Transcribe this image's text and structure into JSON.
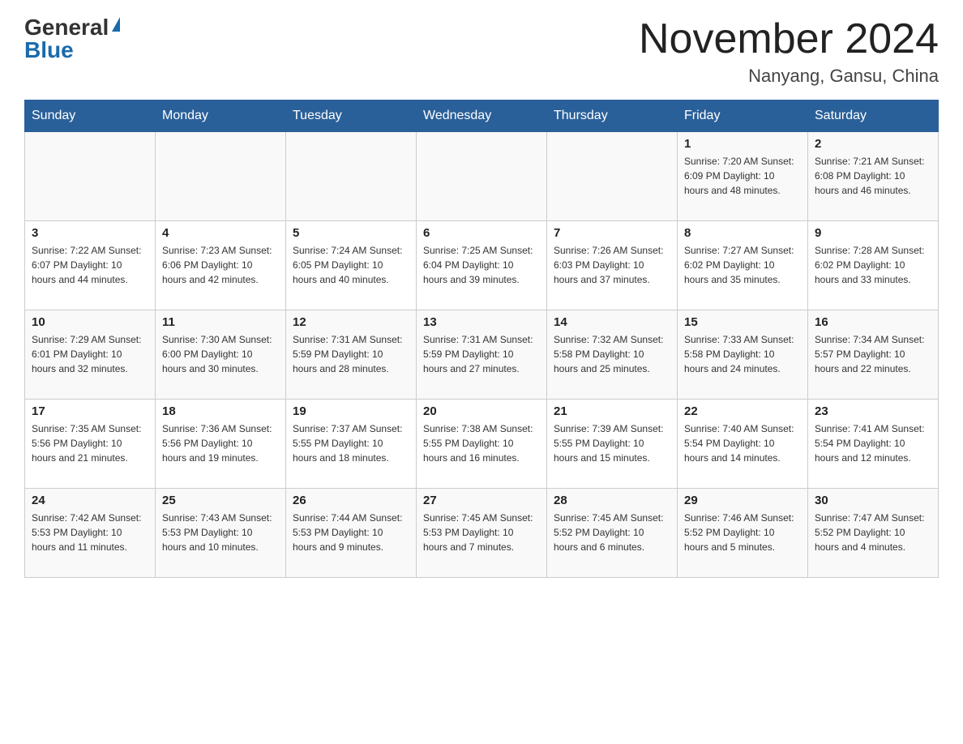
{
  "header": {
    "logo_general": "General",
    "logo_blue": "Blue",
    "title": "November 2024",
    "subtitle": "Nanyang, Gansu, China"
  },
  "days_of_week": [
    "Sunday",
    "Monday",
    "Tuesday",
    "Wednesday",
    "Thursday",
    "Friday",
    "Saturday"
  ],
  "weeks": [
    [
      {
        "day": "",
        "info": ""
      },
      {
        "day": "",
        "info": ""
      },
      {
        "day": "",
        "info": ""
      },
      {
        "day": "",
        "info": ""
      },
      {
        "day": "",
        "info": ""
      },
      {
        "day": "1",
        "info": "Sunrise: 7:20 AM\nSunset: 6:09 PM\nDaylight: 10 hours and 48 minutes."
      },
      {
        "day": "2",
        "info": "Sunrise: 7:21 AM\nSunset: 6:08 PM\nDaylight: 10 hours and 46 minutes."
      }
    ],
    [
      {
        "day": "3",
        "info": "Sunrise: 7:22 AM\nSunset: 6:07 PM\nDaylight: 10 hours and 44 minutes."
      },
      {
        "day": "4",
        "info": "Sunrise: 7:23 AM\nSunset: 6:06 PM\nDaylight: 10 hours and 42 minutes."
      },
      {
        "day": "5",
        "info": "Sunrise: 7:24 AM\nSunset: 6:05 PM\nDaylight: 10 hours and 40 minutes."
      },
      {
        "day": "6",
        "info": "Sunrise: 7:25 AM\nSunset: 6:04 PM\nDaylight: 10 hours and 39 minutes."
      },
      {
        "day": "7",
        "info": "Sunrise: 7:26 AM\nSunset: 6:03 PM\nDaylight: 10 hours and 37 minutes."
      },
      {
        "day": "8",
        "info": "Sunrise: 7:27 AM\nSunset: 6:02 PM\nDaylight: 10 hours and 35 minutes."
      },
      {
        "day": "9",
        "info": "Sunrise: 7:28 AM\nSunset: 6:02 PM\nDaylight: 10 hours and 33 minutes."
      }
    ],
    [
      {
        "day": "10",
        "info": "Sunrise: 7:29 AM\nSunset: 6:01 PM\nDaylight: 10 hours and 32 minutes."
      },
      {
        "day": "11",
        "info": "Sunrise: 7:30 AM\nSunset: 6:00 PM\nDaylight: 10 hours and 30 minutes."
      },
      {
        "day": "12",
        "info": "Sunrise: 7:31 AM\nSunset: 5:59 PM\nDaylight: 10 hours and 28 minutes."
      },
      {
        "day": "13",
        "info": "Sunrise: 7:31 AM\nSunset: 5:59 PM\nDaylight: 10 hours and 27 minutes."
      },
      {
        "day": "14",
        "info": "Sunrise: 7:32 AM\nSunset: 5:58 PM\nDaylight: 10 hours and 25 minutes."
      },
      {
        "day": "15",
        "info": "Sunrise: 7:33 AM\nSunset: 5:58 PM\nDaylight: 10 hours and 24 minutes."
      },
      {
        "day": "16",
        "info": "Sunrise: 7:34 AM\nSunset: 5:57 PM\nDaylight: 10 hours and 22 minutes."
      }
    ],
    [
      {
        "day": "17",
        "info": "Sunrise: 7:35 AM\nSunset: 5:56 PM\nDaylight: 10 hours and 21 minutes."
      },
      {
        "day": "18",
        "info": "Sunrise: 7:36 AM\nSunset: 5:56 PM\nDaylight: 10 hours and 19 minutes."
      },
      {
        "day": "19",
        "info": "Sunrise: 7:37 AM\nSunset: 5:55 PM\nDaylight: 10 hours and 18 minutes."
      },
      {
        "day": "20",
        "info": "Sunrise: 7:38 AM\nSunset: 5:55 PM\nDaylight: 10 hours and 16 minutes."
      },
      {
        "day": "21",
        "info": "Sunrise: 7:39 AM\nSunset: 5:55 PM\nDaylight: 10 hours and 15 minutes."
      },
      {
        "day": "22",
        "info": "Sunrise: 7:40 AM\nSunset: 5:54 PM\nDaylight: 10 hours and 14 minutes."
      },
      {
        "day": "23",
        "info": "Sunrise: 7:41 AM\nSunset: 5:54 PM\nDaylight: 10 hours and 12 minutes."
      }
    ],
    [
      {
        "day": "24",
        "info": "Sunrise: 7:42 AM\nSunset: 5:53 PM\nDaylight: 10 hours and 11 minutes."
      },
      {
        "day": "25",
        "info": "Sunrise: 7:43 AM\nSunset: 5:53 PM\nDaylight: 10 hours and 10 minutes."
      },
      {
        "day": "26",
        "info": "Sunrise: 7:44 AM\nSunset: 5:53 PM\nDaylight: 10 hours and 9 minutes."
      },
      {
        "day": "27",
        "info": "Sunrise: 7:45 AM\nSunset: 5:53 PM\nDaylight: 10 hours and 7 minutes."
      },
      {
        "day": "28",
        "info": "Sunrise: 7:45 AM\nSunset: 5:52 PM\nDaylight: 10 hours and 6 minutes."
      },
      {
        "day": "29",
        "info": "Sunrise: 7:46 AM\nSunset: 5:52 PM\nDaylight: 10 hours and 5 minutes."
      },
      {
        "day": "30",
        "info": "Sunrise: 7:47 AM\nSunset: 5:52 PM\nDaylight: 10 hours and 4 minutes."
      }
    ]
  ]
}
